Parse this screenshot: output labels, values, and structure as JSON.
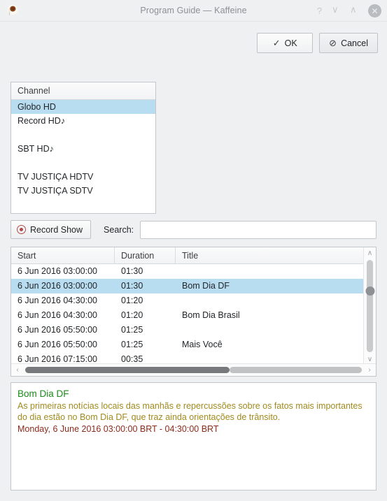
{
  "window": {
    "title": "Program Guide — Kaffeine",
    "app_icon": "coffee-cup-icon",
    "controls": {
      "help": "?",
      "shade": "∨",
      "maximize": "∧",
      "close": "✕"
    }
  },
  "actions": {
    "ok_label": "OK",
    "ok_icon": "✓",
    "cancel_label": "Cancel",
    "cancel_icon": "⊘"
  },
  "channels": {
    "header": "Channel",
    "items": [
      {
        "label": "Globo HD",
        "selected": true
      },
      {
        "label": "Record HD♪",
        "selected": false
      },
      {
        "label": "",
        "selected": false
      },
      {
        "label": "SBT HD♪",
        "selected": false
      },
      {
        "label": "",
        "selected": false
      },
      {
        "label": "TV JUSTIÇA HDTV",
        "selected": false
      },
      {
        "label": "TV JUSTIÇA SDTV",
        "selected": false
      }
    ]
  },
  "toolbar": {
    "record_label": "Record Show",
    "record_icon": "record-dot-icon",
    "search_label": "Search:",
    "search_value": "",
    "search_placeholder": ""
  },
  "table": {
    "columns": [
      "Start",
      "Duration",
      "Title"
    ],
    "rows": [
      {
        "start": "6 Jun 2016 03:00:00",
        "duration": "01:30",
        "title": "",
        "selected": false
      },
      {
        "start": "6 Jun 2016 03:00:00",
        "duration": "01:30",
        "title": "Bom Dia DF",
        "selected": true
      },
      {
        "start": "6 Jun 2016 04:30:00",
        "duration": "01:20",
        "title": "",
        "selected": false
      },
      {
        "start": "6 Jun 2016 04:30:00",
        "duration": "01:20",
        "title": "Bom Dia Brasil",
        "selected": false
      },
      {
        "start": "6 Jun 2016 05:50:00",
        "duration": "01:25",
        "title": "",
        "selected": false
      },
      {
        "start": "6 Jun 2016 05:50:00",
        "duration": "01:25",
        "title": "Mais Você",
        "selected": false
      },
      {
        "start": "6 Jun 2016 07:15:00",
        "duration": "00:35",
        "title": "",
        "selected": false
      }
    ],
    "scroll_up_icon": "∧",
    "scroll_down_icon": "∨",
    "scroll_left_icon": "‹",
    "scroll_right_icon": "›"
  },
  "description": {
    "title": "Bom Dia DF",
    "body": "As primeiras notícias locais das manhãs e repercussões sobre os fatos mais importantes do dia estão no Bom Dia DF, que traz ainda orientações de trânsito.",
    "time": "Monday, 6 June 2016 03:00:00 BRT - 04:30:00 BRT"
  },
  "colors": {
    "dialog_bg": "#eff0f1",
    "selection": "#b8dcf0",
    "desc_title": "#1a8c1a",
    "desc_body": "#a08a1e",
    "desc_time": "#8b2a1a",
    "record_red": "#b4494a"
  }
}
